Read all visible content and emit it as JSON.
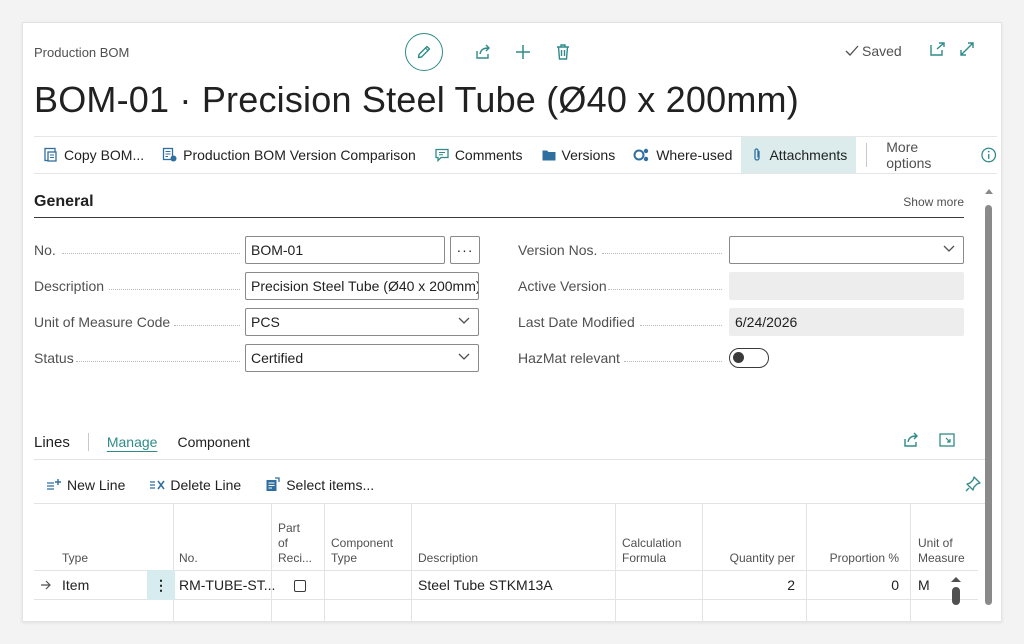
{
  "header": {
    "caption": "Production BOM",
    "title": "BOM-01 · Precision Steel Tube (Ø40 x 200mm)",
    "saved_label": "Saved"
  },
  "actions": {
    "copy_bom": "Copy BOM...",
    "version_comparison": "Production BOM Version Comparison",
    "comments": "Comments",
    "versions": "Versions",
    "where_used": "Where-used",
    "attachments": "Attachments",
    "more_options": "More options"
  },
  "general": {
    "title": "General",
    "show_more": "Show more",
    "no_label": "No.",
    "no_value": "BOM-01",
    "description_label": "Description",
    "description_value": "Precision Steel Tube (Ø40 x 200mm)",
    "uom_label": "Unit of Measure Code",
    "uom_value": "PCS",
    "status_label": "Status",
    "status_value": "Certified",
    "version_nos_label": "Version Nos.",
    "version_nos_value": "",
    "active_version_label": "Active Version",
    "active_version_value": "",
    "last_modified_label": "Last Date Modified",
    "last_modified_value": "6/24/2026",
    "hazmat_label": "HazMat relevant",
    "hazmat_value": false
  },
  "lines": {
    "title": "Lines",
    "tab_manage": "Manage",
    "tab_component": "Component",
    "new_line": "New Line",
    "delete_line": "Delete Line",
    "select_items": "Select items...",
    "columns": {
      "type": "Type",
      "no": "No.",
      "part_of_reci_1": "Part",
      "part_of_reci_2": "of",
      "part_of_reci_3": "Reci...",
      "component_type_1": "Component",
      "component_type_2": "Type",
      "description": "Description",
      "calc_formula_1": "Calculation",
      "calc_formula_2": "Formula",
      "quantity_per": "Quantity per",
      "proportion": "Proportion %",
      "unit_of_measure_1": "Unit of",
      "unit_of_measure_2": "Measure"
    },
    "rows": [
      {
        "type": "Item",
        "no": "RM-TUBE-ST...",
        "part_of_recipe": false,
        "component_type": "",
        "description": "Steel Tube STKM13A",
        "calc_formula": "",
        "quantity_per": "2",
        "proportion": "0",
        "unit_of_measure": "M"
      }
    ]
  },
  "colors": {
    "accent": "#2f8b89",
    "active_action_bg": "#dcecec",
    "selected_cell_bg": "#d6ecee"
  }
}
